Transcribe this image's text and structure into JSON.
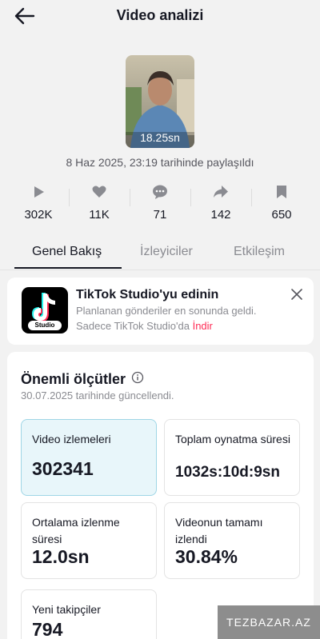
{
  "header": {
    "title": "Video analizi"
  },
  "video": {
    "duration": "18.25sn",
    "posted": "8 Haz 2025, 23:19 tarihinde paylaşıldı"
  },
  "stats": [
    {
      "icon": "play-icon",
      "value": "302K"
    },
    {
      "icon": "heart-icon",
      "value": "11K"
    },
    {
      "icon": "comment-icon",
      "value": "71"
    },
    {
      "icon": "share-icon",
      "value": "142"
    },
    {
      "icon": "bookmark-icon",
      "value": "650"
    }
  ],
  "tabs": [
    {
      "label": "Genel Bakış",
      "active": true
    },
    {
      "label": "İzleyiciler",
      "active": false
    },
    {
      "label": "Etkileşim",
      "active": false
    }
  ],
  "promo": {
    "title": "TikTok Studio'yu edinin",
    "line1": "Planlanan gönderiler en sonunda geldi.",
    "line2_prefix": "Sadece TikTok Studio'da",
    "link": "İndir",
    "logo_text": "Studio"
  },
  "metrics_card": {
    "title": "Önemli ölçütler",
    "updated": "30.07.2025 tarihinde güncellendi.",
    "items": [
      {
        "label": "Video izlemeleri",
        "value": "302341",
        "selected": true
      },
      {
        "label": "Toplam oynatma süresi",
        "value": "1032s:10d:9sn",
        "selected": false
      },
      {
        "label": "Ortalama izlenme süresi",
        "value": "12.0sn",
        "selected": false
      },
      {
        "label": "Videonun tamamı izlendi",
        "value": "30.84%",
        "selected": false
      },
      {
        "label": "Yeni takipçiler",
        "value": "794",
        "selected": false
      }
    ]
  },
  "watermark": "TEZBAZAR.AZ",
  "colors": {
    "accent_link": "#fe2c55",
    "selected_card": "#e8f6fa",
    "text": "#161823",
    "muted": "#8a8b91"
  }
}
